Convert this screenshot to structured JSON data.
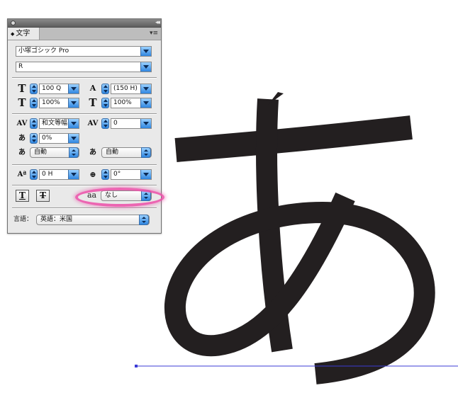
{
  "panel": {
    "tab_label": "文字",
    "font_family": "小塚ゴシック Pro",
    "font_style": "R",
    "font_size": "100 Q",
    "leading": "(150 H)",
    "vertical_scale": "100%",
    "horizontal_scale": "100%",
    "mojikumi": "和文等幅",
    "tracking": "0",
    "tsume": "0%",
    "aki_left": "自動",
    "aki_right": "自動",
    "baseline_shift": "0 H",
    "rotation": "0°",
    "underline_button": "T",
    "strikethrough_button": "T",
    "japanese_option_icon": "aa",
    "japanese_option_value": "なし",
    "language_label": "言語：",
    "language_value": "英語：米国"
  },
  "canvas": {
    "glyph": "あ",
    "glyph_color": "#231f20",
    "baseline_color": "#3b3bd6"
  },
  "accent_colors": {
    "highlight_ring": "#ec4ea8",
    "control_blue": "#2f86e0"
  }
}
